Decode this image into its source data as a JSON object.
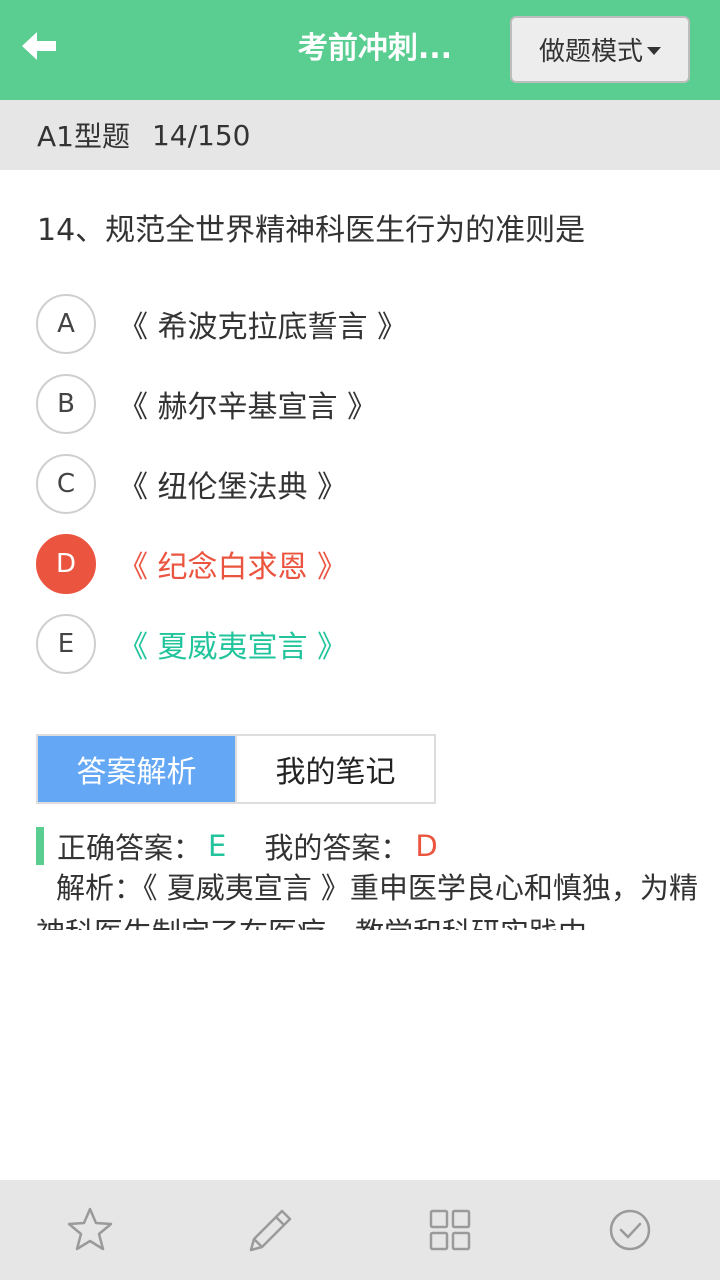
{
  "header": {
    "title": "考前冲刺...",
    "mode_label": "做题模式"
  },
  "subheader": {
    "question_type": "A1型题",
    "progress": "14/150"
  },
  "question": {
    "text": "14、规范全世界精神科医生行为的准则是",
    "options": [
      {
        "letter": "A",
        "text": "《 希波克拉底誓言 》",
        "state": "normal"
      },
      {
        "letter": "B",
        "text": "《 赫尔辛基宣言 》",
        "state": "normal"
      },
      {
        "letter": "C",
        "text": "《 纽伦堡法典 》",
        "state": "normal"
      },
      {
        "letter": "D",
        "text": "《 纪念白求恩 》",
        "state": "wrong"
      },
      {
        "letter": "E",
        "text": "《 夏威夷宣言 》",
        "state": "correct"
      }
    ]
  },
  "tabs": {
    "analysis": "答案解析",
    "notes": "我的笔记"
  },
  "answer": {
    "correct_label": "正确答案：",
    "correct_value": "E",
    "mine_label": "我的答案：",
    "mine_value": "D",
    "analysis_text": "解析：《 夏威夷宣言 》重申医学良心和慎独，为精神科医生制定了在医疗、教学和科研实践中"
  },
  "colors": {
    "brand_green": "#5acd91",
    "wrong_red": "#eb5540",
    "correct_teal": "#21c49b",
    "tab_blue": "#64a7f4"
  },
  "icons": {
    "back": "arrow-left-icon",
    "favorite": "star-icon",
    "note": "pencil-icon",
    "grid": "grid-icon",
    "submit": "check-circle-icon"
  }
}
